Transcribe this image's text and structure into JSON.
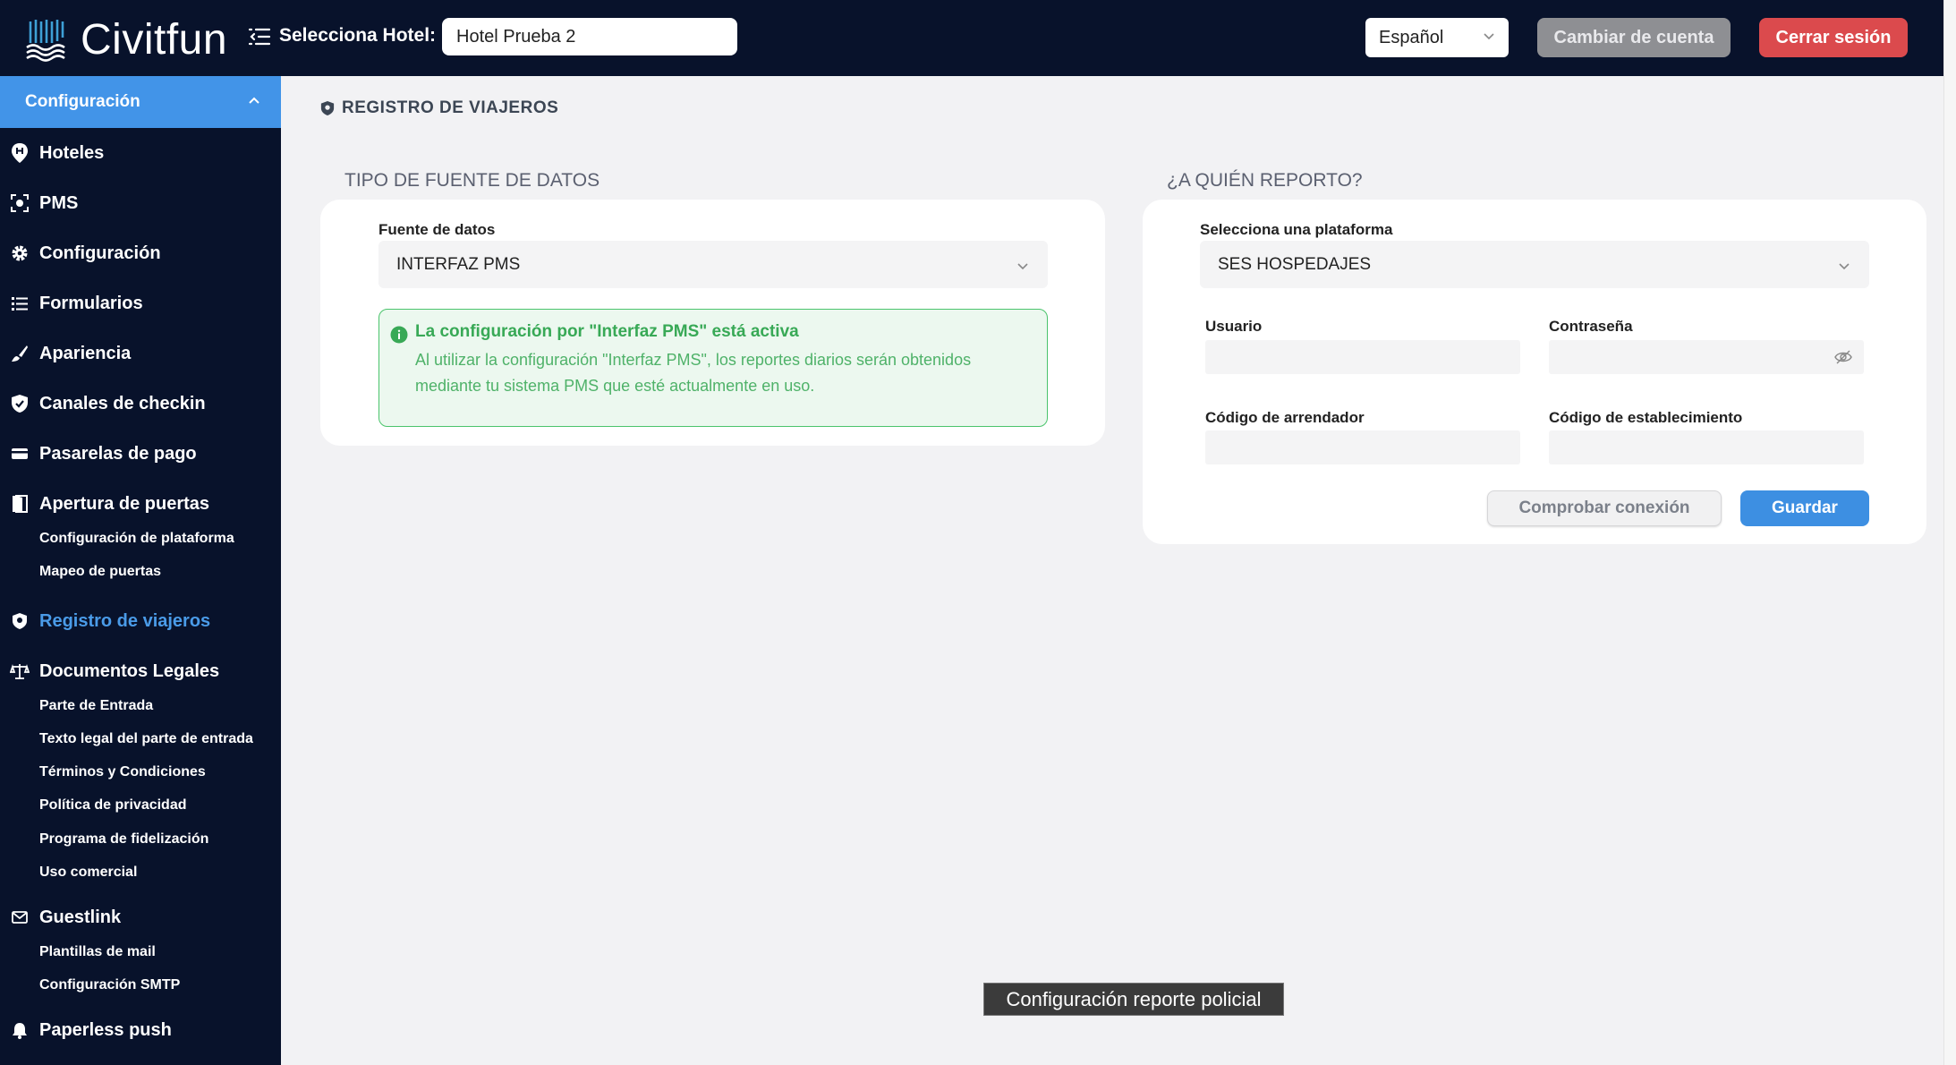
{
  "header": {
    "logo_text": "Civitfun",
    "hotel_label": "Selecciona Hotel:",
    "hotel_value": "Hotel Prueba 2",
    "language": "Español",
    "switch_account": "Cambiar de cuenta",
    "logout": "Cerrar sesión"
  },
  "sidebar": {
    "section": "Configuración",
    "items": {
      "hoteles": "Hoteles",
      "pms": "PMS",
      "configuracion": "Configuración",
      "formularios": "Formularios",
      "apariencia": "Apariencia",
      "canales": "Canales de checkin",
      "pasarelas": "Pasarelas de pago",
      "apertura": "Apertura de puertas",
      "registro": "Registro de viajeros",
      "documentos": "Documentos Legales",
      "guestlink": "Guestlink",
      "paperless": "Paperless push"
    },
    "sub": {
      "config_plataforma": "Configuración de plataforma",
      "mapeo": "Mapeo de puertas",
      "parte_entrada": "Parte de Entrada",
      "texto_legal": "Texto legal del parte de entrada",
      "terminos": "Términos y Condiciones",
      "privacidad": "Política de privacidad",
      "fidelizacion": "Programa de fidelización",
      "uso_comercial": "Uso comercial",
      "plantillas": "Plantillas de mail",
      "smtp": "Configuración SMTP"
    }
  },
  "main": {
    "page_title": "REGISTRO DE VIAJEROS",
    "source": {
      "section_title": "TIPO DE FUENTE DE DATOS",
      "field_label": "Fuente de datos",
      "field_value": "INTERFAZ PMS",
      "alert_title": "La configuración por \"Interfaz PMS\" está activa",
      "alert_body": "Al utilizar la configuración \"Interfaz PMS\", los reportes diarios serán obtenidos mediante tu sistema PMS que esté actualmente en uso."
    },
    "report": {
      "section_title": "¿A QUIÉN REPORTO?",
      "platform_label": "Selecciona una plataforma",
      "platform_value": "SES HOSPEDAJES",
      "user_label": "Usuario",
      "password_label": "Contraseña",
      "lessor_label": "Código de arrendador",
      "establishment_label": "Código de establecimiento",
      "test_button": "Comprobar conexión",
      "save_button": "Guardar"
    }
  },
  "tooltip": "Configuración reporte policial",
  "colors": {
    "topbar": "#08122b",
    "accent": "#4294e8",
    "danger": "#db4a4d",
    "success": "#38a956"
  }
}
